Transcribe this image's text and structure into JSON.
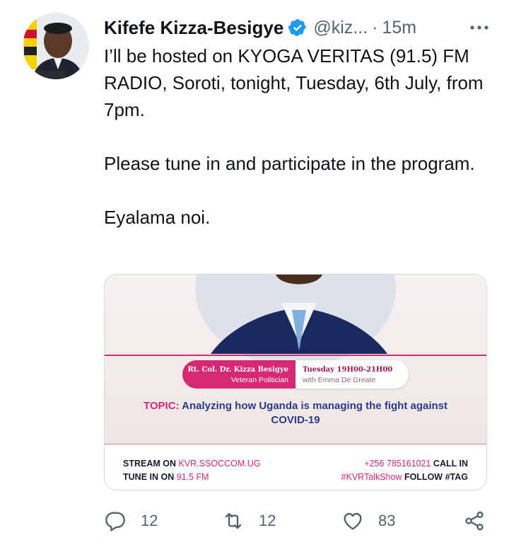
{
  "author": {
    "name": "Kifefe Kizza-Besigye",
    "handle": "@kiz...",
    "separator": "·",
    "time": "15m",
    "avatar_icon": "profile-photo"
  },
  "tweet": {
    "paragraphs": [
      "I’ll be hosted on KYOGA VERITAS (91.5) FM RADIO, Soroti, tonight, Tuesday, 6th July, from 7pm.",
      "Please tune in and participate in the program.",
      "Eyalama noi."
    ]
  },
  "media": {
    "guest_name": "Rt. Col. Dr. Kizza Besigye",
    "guest_title": "Veteran Politician",
    "show_time": "Tuesday 19H00-21H00",
    "host": "with Emma De Greate",
    "topic_label": "TOPIC:",
    "topic_text": "Analyzing how Uganda is managing the fight against COVID-19",
    "stream_label": "STREAM ON",
    "stream_value": "KVR.SSOCCOM.UG",
    "tune_label": "TUNE IN ON",
    "tune_value": "91.5 FM",
    "phone": "+256 785161021",
    "call_label": "CALL IN",
    "hashtag": "#KVRTalkShow",
    "follow_label": "FOLLOW #TAG"
  },
  "actions": {
    "replies": "12",
    "retweets": "12",
    "likes": "83"
  },
  "colors": {
    "verified": "#1d9bf0",
    "accent_pink": "#d62873",
    "text_secondary": "#536471"
  }
}
